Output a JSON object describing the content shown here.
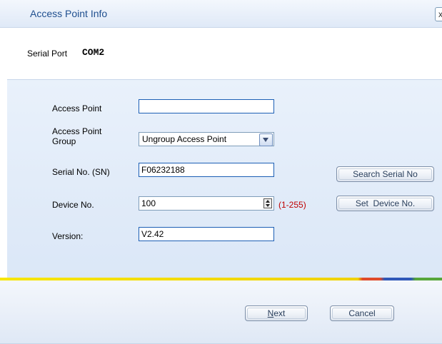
{
  "window": {
    "title": "Access Point Info",
    "close_label": "x"
  },
  "header": {
    "serial_port_label": "Serial Port",
    "serial_port_value": "COM2"
  },
  "form": {
    "access_point": {
      "label": "Access Point",
      "value": ""
    },
    "group": {
      "label_line1": "Access Point",
      "label_line2": "Group",
      "value": "Ungroup Access Point"
    },
    "serial_no": {
      "label": "Serial No. (SN)",
      "value": "F06232188"
    },
    "device_no": {
      "label": "Device No.",
      "value": "100",
      "range_hint": "(1-255)"
    },
    "version": {
      "label": "Version:",
      "value": "V2.42"
    }
  },
  "buttons": {
    "search_serial": "Search Serial No",
    "set_device": "Set  Device No.",
    "next_mnemonic": "N",
    "next_rest": "ext",
    "cancel": "Cancel"
  },
  "colors": {
    "accent": "#1c5fb5",
    "hint": "#c00000",
    "panel": "#dbe7f7"
  }
}
